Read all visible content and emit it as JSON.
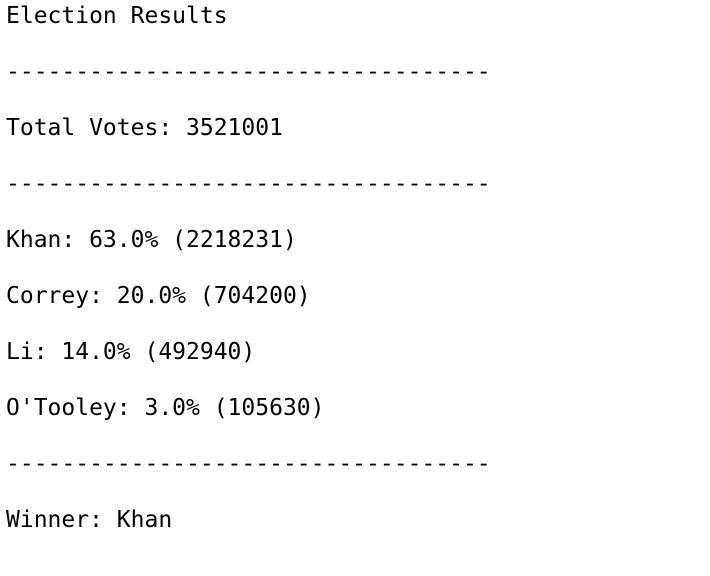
{
  "output": {
    "title": "Election Results",
    "divider": "-----------------------------------",
    "total_votes": "Total Votes: 3521001",
    "candidates": [
      "Khan: 63.0% (2218231)",
      "Correy: 20.0% (704200)",
      "Li: 14.0% (492940)",
      "O'Tooley: 3.0% (105630)"
    ],
    "winner": "Winner: Khan"
  }
}
